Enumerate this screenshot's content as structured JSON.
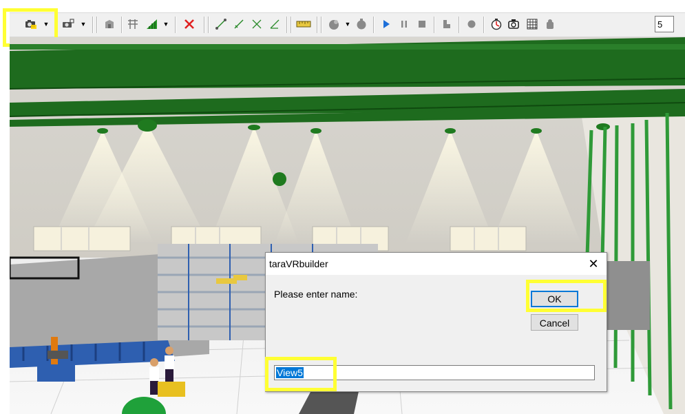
{
  "toolbar": {
    "buttons": [
      {
        "name": "camera-view-icon",
        "symbol": "📷"
      },
      {
        "name": "camera-add-icon",
        "symbol": "📷"
      },
      {
        "name": "object-icon",
        "symbol": "▇"
      },
      {
        "name": "grid-icon",
        "symbol": "#"
      },
      {
        "name": "ramp-icon",
        "symbol": "◢"
      },
      {
        "name": "delete-icon",
        "symbol": "✕"
      },
      {
        "name": "path-line-icon",
        "symbol": "/"
      },
      {
        "name": "path-curve-icon",
        "symbol": "/"
      },
      {
        "name": "path-cross-icon",
        "symbol": "✕"
      },
      {
        "name": "path-angle-icon",
        "symbol": "∠"
      },
      {
        "name": "measure-ruler-icon",
        "symbol": "▭"
      },
      {
        "name": "robot-icon",
        "symbol": "⚙"
      },
      {
        "name": "robot-alt-icon",
        "symbol": "⚙"
      },
      {
        "name": "play-icon",
        "symbol": "▶"
      },
      {
        "name": "pause-icon",
        "symbol": "❚❚"
      },
      {
        "name": "stop-icon",
        "symbol": "■"
      },
      {
        "name": "step-icon",
        "symbol": "▙"
      },
      {
        "name": "record-icon",
        "symbol": "●"
      },
      {
        "name": "timer-icon",
        "symbol": "⏱"
      },
      {
        "name": "camera-settings-icon",
        "symbol": "⚙"
      },
      {
        "name": "table-icon",
        "symbol": "▦"
      },
      {
        "name": "person-icon",
        "symbol": "☗"
      }
    ],
    "speed_value": "5",
    "colors": {
      "highlight": "#ffff33",
      "play": "#1e6fd9",
      "delete": "#e02020",
      "ramp": "#2a9b2a"
    }
  },
  "dialog": {
    "title": "taraVRbuilder",
    "close_symbol": "✕",
    "prompt": "Please enter name:",
    "ok_label": "OK",
    "cancel_label": "Cancel",
    "name_value": "View5"
  },
  "scene": {
    "colors": {
      "beam": "#1e6b1e",
      "wall": "#d8d6d0",
      "floor": "#f2f2f2",
      "pillar": "#2f9a38",
      "conveyor": "#2e5fb0"
    }
  }
}
